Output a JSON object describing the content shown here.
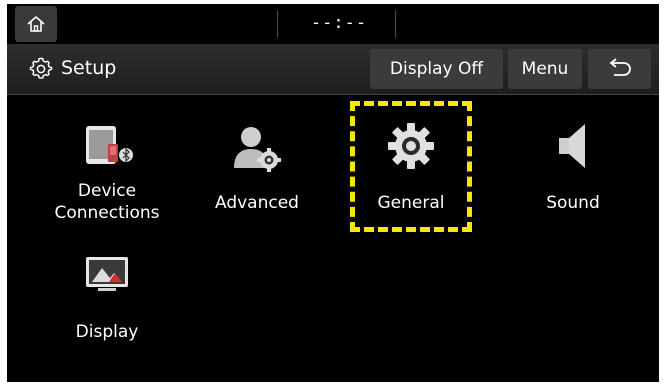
{
  "status_bar": {
    "clock": "--:--",
    "home_icon": "home-icon"
  },
  "title_bar": {
    "title": "Setup",
    "title_icon": "gear-outline-icon",
    "display_off_label": "Display Off",
    "menu_label": "Menu",
    "back_icon": "back-arrow-icon"
  },
  "menu_items": [
    {
      "label_line1": "Device",
      "label_line2": "Connections",
      "icon": "device-bluetooth-icon"
    },
    {
      "label": "Advanced",
      "icon": "person-gear-icon"
    },
    {
      "label": "General",
      "icon": "gear-icon",
      "highlighted": true
    },
    {
      "label": "Sound",
      "icon": "speaker-icon"
    },
    {
      "label": "Display",
      "icon": "monitor-icon"
    }
  ],
  "colors": {
    "highlight": "#f5e800",
    "background": "#000000",
    "button": "#3b3b3b"
  }
}
